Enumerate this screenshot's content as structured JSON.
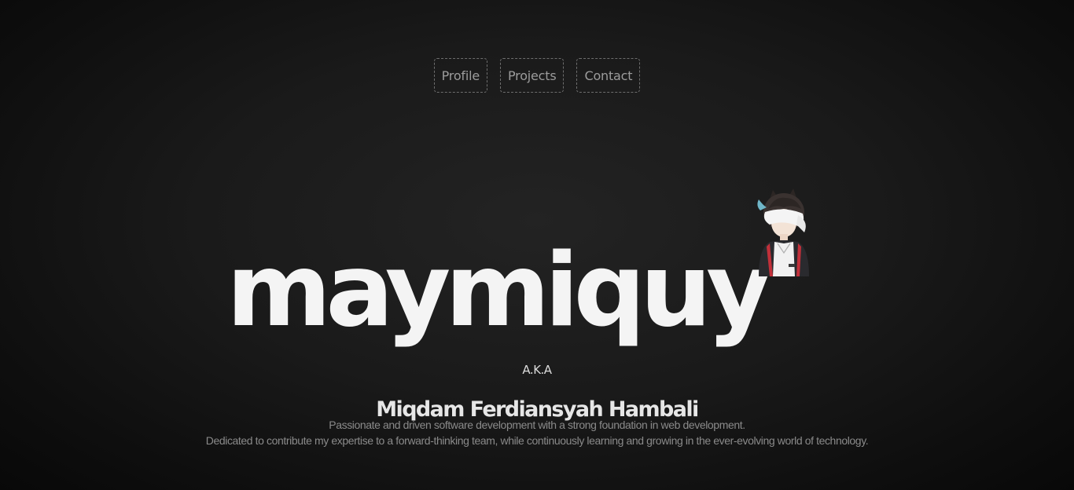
{
  "nav": {
    "items": [
      {
        "label": "Profile"
      },
      {
        "label": "Projects"
      },
      {
        "label": "Contact"
      }
    ]
  },
  "hero": {
    "title": "maymiquy",
    "avatar_icon": "anime-avatar-icon"
  },
  "intro": {
    "aka": "A.K.A",
    "full_name": "Miqdam Ferdiansyah Hambali",
    "description_lines": [
      "Passionate and driven software development with a strong foundation in web development.",
      "Dedicated to contribute my expertise to a forward-thinking team, while continuously learning and growing in the ever-evolving world of technology."
    ]
  },
  "colors": {
    "background": "#141414",
    "title": "#f4f4f4",
    "nav_border": "#6e6e6e",
    "nav_text": "#9c9c9c",
    "description": "#8a8a8a"
  }
}
